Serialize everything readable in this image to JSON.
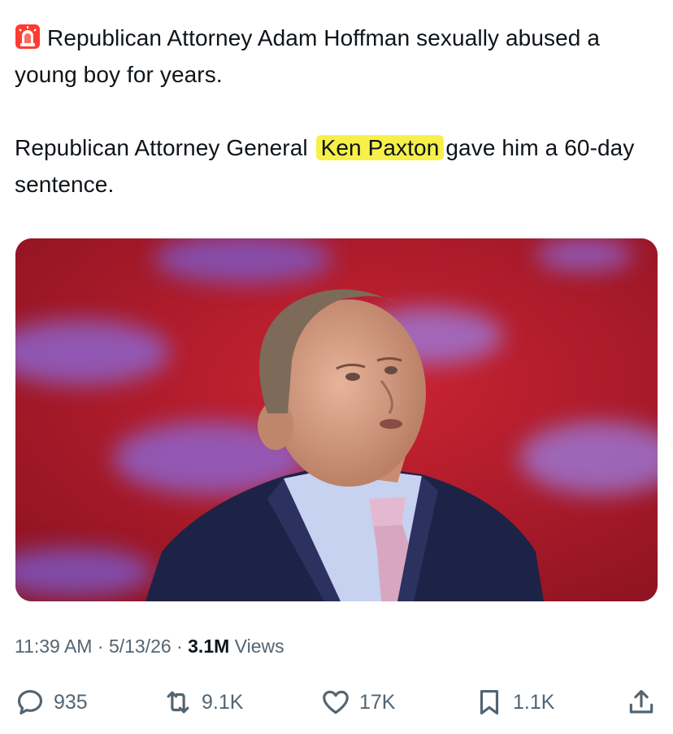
{
  "tweet": {
    "line1": "Republican Attorney Adam Hoffman sexually abused a young boy for years.",
    "line2_before": "Republican Attorney General",
    "line2_highlight": "Ken Paxton",
    "line2_after": "gave him a 60-day sentence.",
    "highlight_color": "#f7f04a",
    "emoji_icon": "police-siren-icon"
  },
  "media": {
    "icon": "photo-man-looking-up"
  },
  "meta": {
    "time": "11:39 AM",
    "sep1": "·",
    "date": "5/13/26",
    "sep2": "·",
    "views_count": "3.1M",
    "views_label": "Views"
  },
  "actions": {
    "replies": "935",
    "reposts": "9.1K",
    "likes": "17K",
    "bookmarks": "1.1K"
  },
  "colors": {
    "text": "#0f1419",
    "secondary": "#536471",
    "media_bg": "#b81f2c"
  }
}
